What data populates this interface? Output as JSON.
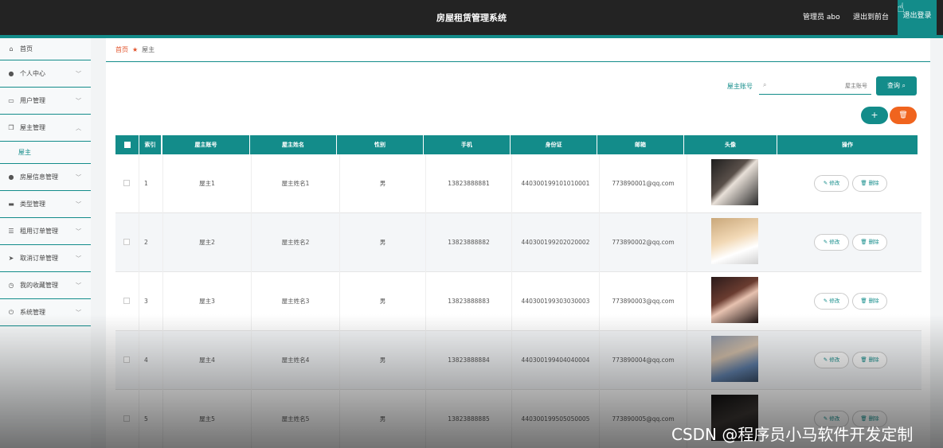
{
  "header": {
    "title": "房屋租赁管理系统",
    "user": "管理员 abo",
    "front": "退出到前台",
    "logout": "退出登录"
  },
  "sidebar": {
    "items": [
      {
        "icon": "home-icon",
        "label": "首页",
        "chevron": ""
      },
      {
        "icon": "user-icon",
        "label": "个人中心",
        "chevron": "﹀"
      },
      {
        "icon": "id-card-icon",
        "label": "用户管理",
        "chevron": "﹀"
      },
      {
        "icon": "copy-icon",
        "label": "屋主管理",
        "chevron": "︿"
      },
      {
        "icon": "",
        "label": "屋主",
        "chevron": ""
      },
      {
        "icon": "user-icon",
        "label": "房屋信息管理",
        "chevron": "﹀"
      },
      {
        "icon": "briefcase-icon",
        "label": "类型管理",
        "chevron": "﹀"
      },
      {
        "icon": "sliders-icon",
        "label": "租用订单管理",
        "chevron": "﹀"
      },
      {
        "icon": "send-icon",
        "label": "取消订单管理",
        "chevron": "﹀"
      },
      {
        "icon": "clock-icon",
        "label": "我的收藏管理",
        "chevron": "﹀"
      },
      {
        "icon": "power-icon",
        "label": "系统管理",
        "chevron": "﹀"
      }
    ]
  },
  "breadcrumb": {
    "home": "首页",
    "current": "屋主"
  },
  "search": {
    "label": "屋主账号",
    "placeholder": "屋主账号",
    "button": "查询"
  },
  "actions": {
    "add": "+",
    "delete": "🗑"
  },
  "table": {
    "headers": [
      "",
      "索引",
      "屋主账号",
      "屋主姓名",
      "性别",
      "手机",
      "身份证",
      "邮箱",
      "头像",
      "操作"
    ],
    "edit_label": "✎ 修改",
    "delete_label": "🗑 删除",
    "rows": [
      {
        "idx": "1",
        "account": "屋主1",
        "name": "屋主姓名1",
        "gender": "男",
        "phone": "13823888881",
        "idcard": "440300199101010001",
        "email": "773890001@qq.com"
      },
      {
        "idx": "2",
        "account": "屋主2",
        "name": "屋主姓名2",
        "gender": "男",
        "phone": "13823888882",
        "idcard": "440300199202020002",
        "email": "773890002@qq.com"
      },
      {
        "idx": "3",
        "account": "屋主3",
        "name": "屋主姓名3",
        "gender": "男",
        "phone": "13823888883",
        "idcard": "440300199303030003",
        "email": "773890003@qq.com"
      },
      {
        "idx": "4",
        "account": "屋主4",
        "name": "屋主姓名4",
        "gender": "男",
        "phone": "13823888884",
        "idcard": "440300199404040004",
        "email": "773890004@qq.com"
      },
      {
        "idx": "5",
        "account": "屋主5",
        "name": "屋主姓名5",
        "gender": "男",
        "phone": "13823888885",
        "idcard": "440300199505050005",
        "email": "773890005@qq.com"
      }
    ]
  },
  "watermark": "CSDN @程序员小马软件开发定制",
  "colors": {
    "accent": "#138c8a",
    "danger": "#f0641e",
    "topbar": "#232323"
  }
}
